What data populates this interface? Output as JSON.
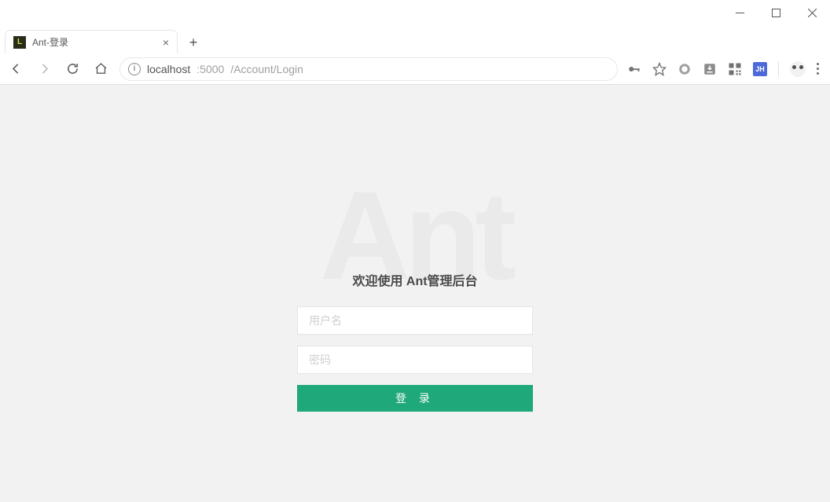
{
  "browser": {
    "tab_title": "Ant-登录",
    "favicon_letter": "L",
    "address": {
      "host": "localhost",
      "port": ":5000",
      "path": "/Account/Login"
    },
    "ext_badge": "JH"
  },
  "page": {
    "watermark": "Ant",
    "title": "欢迎使用 Ant管理后台",
    "username_placeholder": "用户名",
    "password_placeholder": "密码",
    "login_button": "登 录"
  }
}
